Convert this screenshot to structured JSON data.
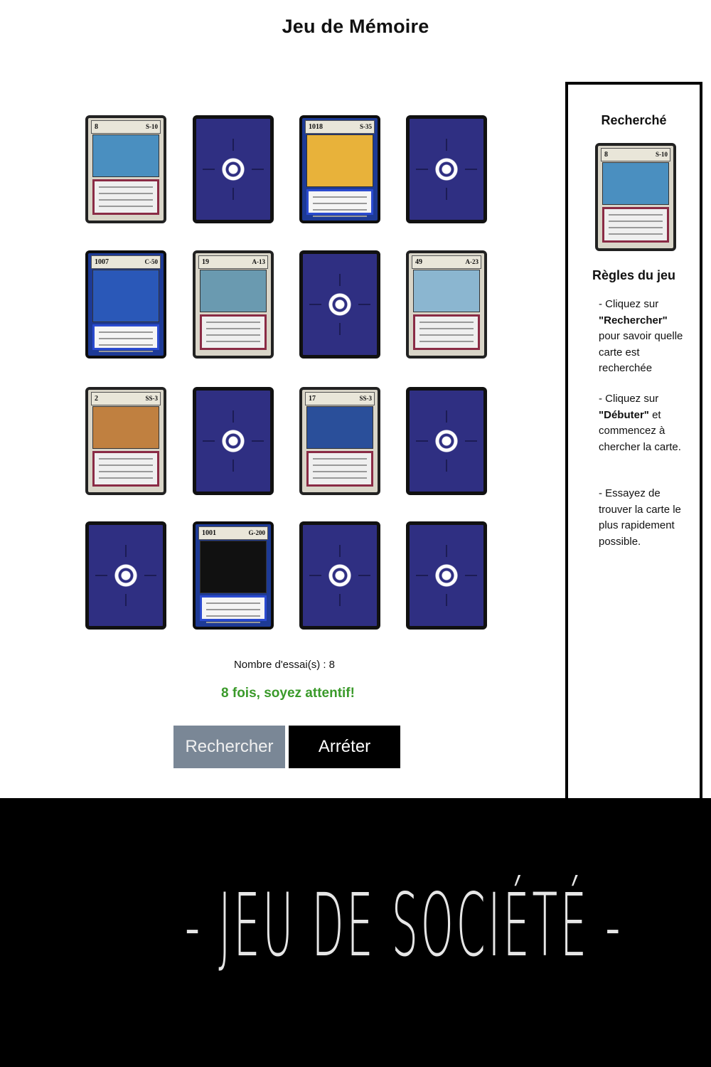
{
  "app_title": "Jeu de Mémoire",
  "cards": [
    {
      "state": "front",
      "style": "plain",
      "number": "8",
      "value": "S-10",
      "art": "#4a8fc0"
    },
    {
      "state": "back"
    },
    {
      "state": "front",
      "style": "blue",
      "number": "1018",
      "value": "S-35",
      "art": "#e8b23a"
    },
    {
      "state": "back"
    },
    {
      "state": "front",
      "style": "blue",
      "number": "1007",
      "value": "C-50",
      "art": "#2a58b8"
    },
    {
      "state": "front",
      "style": "plain",
      "number": "19",
      "value": "A-13",
      "art": "#6a9ab0"
    },
    {
      "state": "back"
    },
    {
      "state": "front",
      "style": "plain",
      "number": "49",
      "value": "A-23",
      "art": "#8bb6d0"
    },
    {
      "state": "front",
      "style": "plain",
      "number": "2",
      "value": "SS-3",
      "art": "#c08040"
    },
    {
      "state": "back"
    },
    {
      "state": "front",
      "style": "plain",
      "number": "17",
      "value": "SS-3",
      "art": "#2a4f9a"
    },
    {
      "state": "back"
    },
    {
      "state": "back"
    },
    {
      "state": "front",
      "style": "blue",
      "number": "1001",
      "value": "G-200",
      "art": "#111111"
    },
    {
      "state": "back"
    },
    {
      "state": "back"
    }
  ],
  "sidebar": {
    "search_title": "Recherché",
    "target_card": {
      "number": "8",
      "value": "S-10",
      "art": "#4a8fc0"
    },
    "rules_title": "Règles du jeu",
    "rule1_pre": "- Cliquez sur ",
    "rule1_bold": "\"Rechercher\"",
    "rule1_post": " pour savoir quelle carte est recherchée",
    "rule2_pre": "- Cliquez sur ",
    "rule2_bold": "\"Débuter\"",
    "rule2_post": " et commencez à chercher la carte.",
    "rule3": "- Essayez de trouver la carte le plus rapidement possible."
  },
  "counter_label": "Nombre d'essai(s) : 8",
  "status_message": "8 fois, soyez attentif!",
  "buttons": {
    "search": "Rechercher",
    "stop": "Arréter"
  },
  "footer_text": "- JEU DE SOCIÉTÉ -",
  "colors": {
    "card_back": "#2f2f82",
    "status_green": "#3a9a2a",
    "search_btn": "#7a8796",
    "footer_bg": "#000000"
  }
}
